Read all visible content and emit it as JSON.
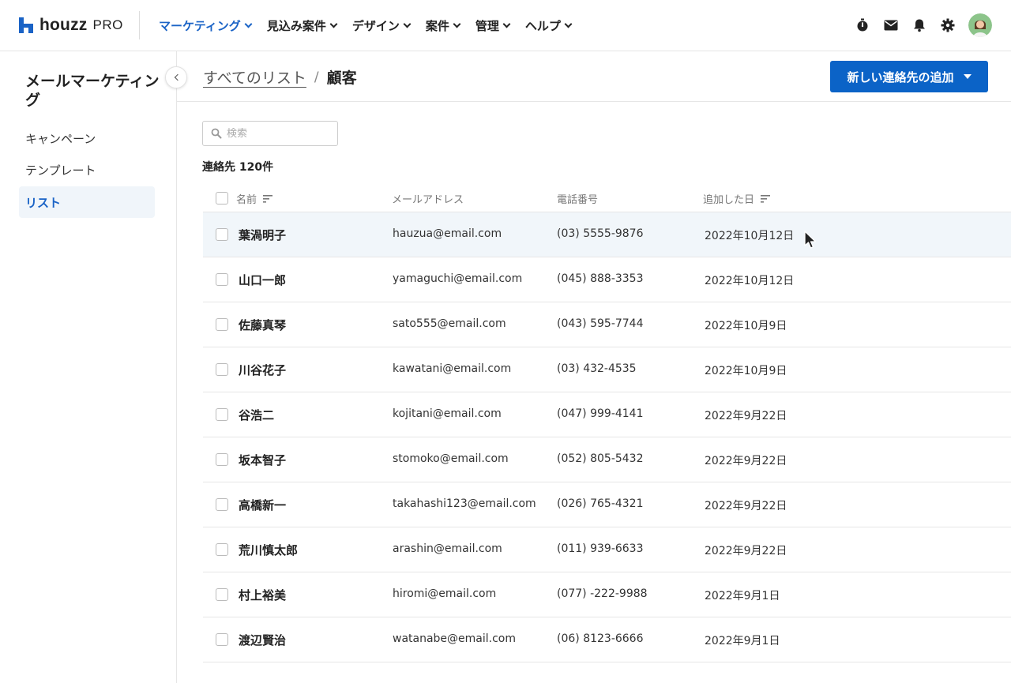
{
  "brand": {
    "logo_text": "houzz",
    "logo_suffix": "PRO",
    "accent": "#1a63c6"
  },
  "nav": [
    {
      "label": "マーケティング",
      "active": true
    },
    {
      "label": "見込み案件",
      "active": false
    },
    {
      "label": "デザイン",
      "active": false
    },
    {
      "label": "案件",
      "active": false
    },
    {
      "label": "管理",
      "active": false
    },
    {
      "label": "ヘルプ",
      "active": false
    }
  ],
  "top_icons": [
    "stopwatch-icon",
    "mail-icon",
    "bell-icon",
    "gear-icon",
    "avatar"
  ],
  "sidebar": {
    "title": "メールマーケティング",
    "items": [
      {
        "label": "キャンペーン",
        "active": false
      },
      {
        "label": "テンプレート",
        "active": false
      },
      {
        "label": "リスト",
        "active": true
      }
    ]
  },
  "breadcrumb": {
    "parent": "すべてのリスト",
    "separator": "/",
    "current": "顧客"
  },
  "add_button": {
    "label": "新しい連絡先の追加"
  },
  "search": {
    "placeholder": "検索",
    "value": ""
  },
  "count_label": "連絡先 120件",
  "table": {
    "columns": {
      "name": "名前",
      "email": "メールアドレス",
      "phone": "電話番号",
      "date": "追加した日"
    },
    "rows": [
      {
        "name": "葉渦明子",
        "email": "hauzua@email.com",
        "phone": "(03) 5555-9876",
        "date": "2022年10月12日"
      },
      {
        "name": "山口一郎",
        "email": "yamaguchi@email.com",
        "phone": "(045) 888-3353",
        "date": "2022年10月12日"
      },
      {
        "name": "佐藤真琴",
        "email": "sato555@email.com",
        "phone": "(043) 595-7744",
        "date": "2022年10月9日"
      },
      {
        "name": "川谷花子",
        "email": "kawatani@email.com",
        "phone": "(03) 432-4535",
        "date": "2022年10月9日"
      },
      {
        "name": "谷浩二",
        "email": "kojitani@email.com",
        "phone": "(047) 999-4141",
        "date": "2022年9月22日"
      },
      {
        "name": "坂本智子",
        "email": "stomoko@email.com",
        "phone": "(052) 805-5432",
        "date": "2022年9月22日"
      },
      {
        "name": "高橋新一",
        "email": "takahashi123@email.com",
        "phone": "(026) 765-4321",
        "date": "2022年9月22日"
      },
      {
        "name": "荒川慎太郎",
        "email": "arashin@email.com",
        "phone": "(011) 939-6633",
        "date": "2022年9月22日"
      },
      {
        "name": "村上裕美",
        "email": "hiromi@email.com",
        "phone": "(077) -222-9988",
        "date": "2022年9月1日"
      },
      {
        "name": "渡辺賢治",
        "email": "watanabe@email.com",
        "phone": "(06) 8123-6666",
        "date": "2022年9月1日"
      }
    ]
  }
}
